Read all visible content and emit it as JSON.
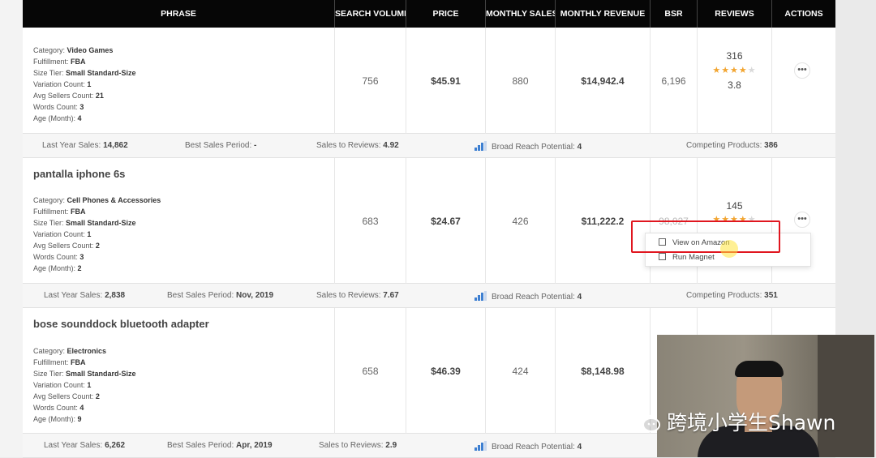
{
  "header": {
    "columns": [
      "PHRASE",
      "SEARCH VOLUME",
      "PRICE",
      "MONTHLY SALES",
      "MONTHLY REVENUE",
      "BSR",
      "REVIEWS",
      "ACTIONS"
    ]
  },
  "rows": [
    {
      "title": "",
      "category": "Video Games",
      "fulfillment": "FBA",
      "size_tier": "Small Standard-Size",
      "variation_count": "1",
      "avg_sellers_count": "21",
      "words_count": "3",
      "age_month": "4",
      "search_volume": "756",
      "price": "$45.91",
      "monthly_sales": "880",
      "monthly_revenue": "$14,942.4",
      "bsr": "6,196",
      "reviews_count": "316",
      "rating": "3.8",
      "rating_stars": 4,
      "summary": {
        "last_year_sales": "14,862",
        "best_sales_period": "-",
        "sales_to_reviews": "4.92",
        "broad_reach_potential": "4",
        "competing_products": "386"
      }
    },
    {
      "title": "pantalla iphone 6s",
      "category": "Cell Phones & Accessories",
      "fulfillment": "FBA",
      "size_tier": "Small Standard-Size",
      "variation_count": "1",
      "avg_sellers_count": "2",
      "words_count": "3",
      "age_month": "2",
      "search_volume": "683",
      "price": "$24.67",
      "monthly_sales": "426",
      "monthly_revenue": "$11,222.2",
      "bsr": "98,027",
      "reviews_count": "145",
      "rating": "",
      "rating_stars": 4,
      "summary": {
        "last_year_sales": "2,838",
        "best_sales_period": "Nov, 2019",
        "sales_to_reviews": "7.67",
        "broad_reach_potential": "4",
        "competing_products": "351"
      }
    },
    {
      "title": "bose sounddock bluetooth adapter",
      "category": "Electronics",
      "fulfillment": "FBA",
      "size_tier": "Small Standard-Size",
      "variation_count": "1",
      "avg_sellers_count": "2",
      "words_count": "4",
      "age_month": "9",
      "search_volume": "658",
      "price": "$46.39",
      "monthly_sales": "424",
      "monthly_revenue": "$8,148.98",
      "summary": {
        "last_year_sales": "6,262",
        "best_sales_period": "Apr, 2019",
        "sales_to_reviews": "2.9",
        "broad_reach_potential": "4"
      }
    }
  ],
  "labels": {
    "category": "Category:",
    "fulfillment": "Fulfillment:",
    "size_tier": "Size Tier:",
    "variation_count": "Variation Count:",
    "avg_sellers_count": "Avg Sellers Count:",
    "words_count": "Words Count:",
    "age_month": "Age (Month):",
    "last_year_sales": "Last Year Sales:",
    "best_sales_period": "Best Sales Period:",
    "sales_to_reviews": "Sales to Reviews:",
    "broad_reach_potential": "Broad Reach Potential:",
    "competing_products": "Competing Products:"
  },
  "actions": {
    "button_label": "•••",
    "menu": [
      "View on Amazon",
      "Run Magnet"
    ]
  },
  "watermark": {
    "text": "跨境小学生Shawn",
    "icon": "wechat-icon"
  },
  "colors": {
    "header_bg": "#060606",
    "highlight": "#e0161f",
    "star": "#f2a531",
    "bars": "#3d7fd1"
  }
}
